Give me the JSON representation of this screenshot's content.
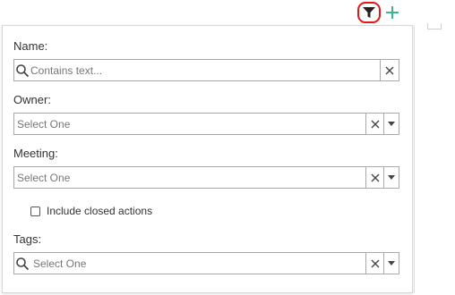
{
  "toolbar": {
    "filter_icon": "funnel-icon",
    "add_icon": "plus-icon",
    "accent_add": "#3db48a",
    "highlight": "#e01818"
  },
  "filters": {
    "name": {
      "label": "Name:",
      "placeholder": "Contains text..."
    },
    "owner": {
      "label": "Owner:",
      "placeholder": "Select One"
    },
    "meeting": {
      "label": "Meeting:",
      "placeholder": "Select One"
    },
    "include_closed": {
      "label": "Include closed actions",
      "checked": false
    },
    "tags": {
      "label": "Tags:",
      "placeholder": "Select One"
    }
  }
}
